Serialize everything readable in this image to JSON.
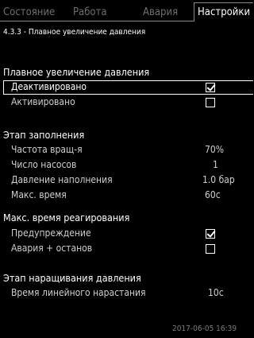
{
  "tabs": {
    "status": "Состояние",
    "operation": "Работа",
    "alarm": "Авария",
    "settings": "Настройки"
  },
  "breadcrumb": "4.3.3 - Плавное увеличение давления",
  "soft_pressure": {
    "heading": "Плавное увеличение давления",
    "options": [
      {
        "label": "Деактивировано",
        "checked": true
      },
      {
        "label": "Активировано",
        "checked": false
      }
    ]
  },
  "fill_stage": {
    "heading": "Этап заполнения",
    "rows": [
      {
        "label": "Частота вращ-я",
        "value": "70%"
      },
      {
        "label": "Число насосов",
        "value": "1"
      },
      {
        "label": "Давление наполнения",
        "value": "1.0 бар"
      },
      {
        "label": "Макс. время",
        "value": "60с"
      }
    ]
  },
  "max_reaction": {
    "heading": "Макс. время реагирования",
    "options": [
      {
        "label": "Предупреждение",
        "checked": true
      },
      {
        "label": "Авария + останов",
        "checked": false
      }
    ]
  },
  "ramp_stage": {
    "heading": "Этап наращивания давления",
    "rows": [
      {
        "label": "Время линейного нарастания",
        "value": "10с"
      }
    ]
  },
  "footer": {
    "datetime": "2017-06-05 16:39"
  }
}
